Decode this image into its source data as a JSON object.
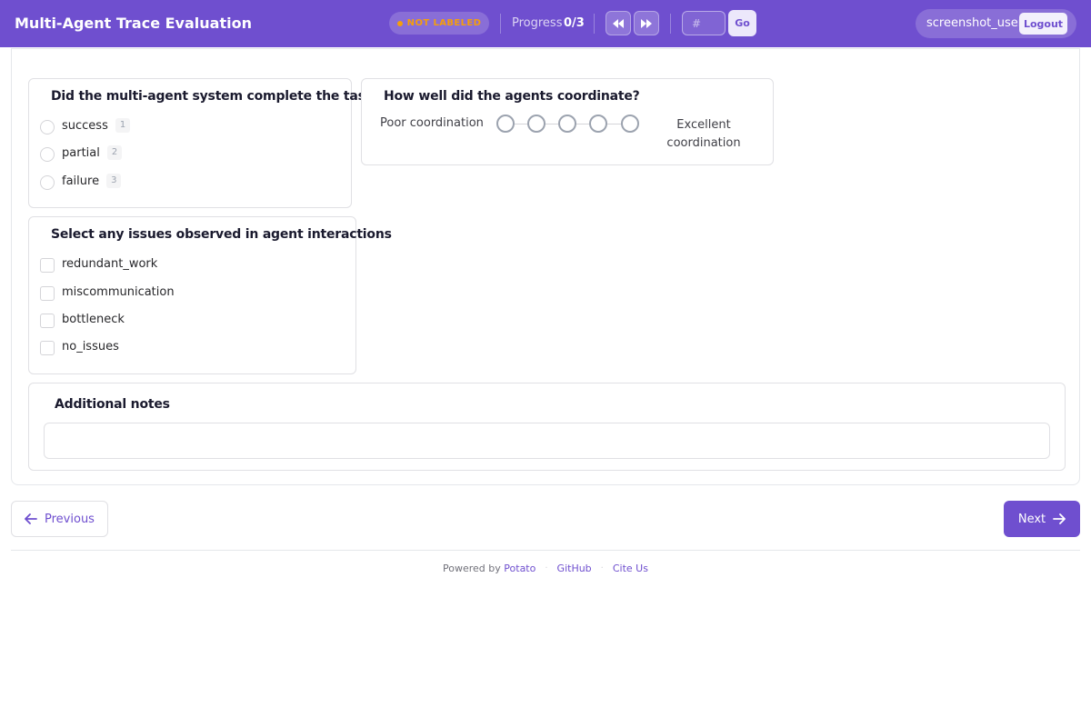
{
  "header": {
    "title": "Multi-Agent Trace Evaluation",
    "status": "NOT LABELED",
    "progress_label": "Progress",
    "progress_value": "0/3",
    "jump_placeholder": "#",
    "go_label": "Go",
    "username": "screenshot_user",
    "logout_label": "Logout"
  },
  "task_completion": {
    "question": "Did the multi-agent system complete the task?",
    "options": [
      {
        "label": "success",
        "key": "1"
      },
      {
        "label": "partial",
        "key": "2"
      },
      {
        "label": "failure",
        "key": "3"
      }
    ]
  },
  "coordination": {
    "question": "How well did the agents coordinate?",
    "min_label": "Poor coordination",
    "max_label": "Excellent coordination",
    "scale_points": 5
  },
  "issues": {
    "question": "Select any issues observed in agent interactions",
    "options": [
      "redundant_work",
      "miscommunication",
      "bottleneck",
      "no_issues"
    ]
  },
  "notes": {
    "title": "Additional notes",
    "value": ""
  },
  "navigation": {
    "previous_label": "Previous",
    "next_label": "Next"
  },
  "footer": {
    "powered_by": "Powered by",
    "potato": "Potato",
    "github": "GitHub",
    "cite": "Cite Us"
  },
  "colors": {
    "accent": "#6f4fcf",
    "status": "#f59e0b"
  }
}
